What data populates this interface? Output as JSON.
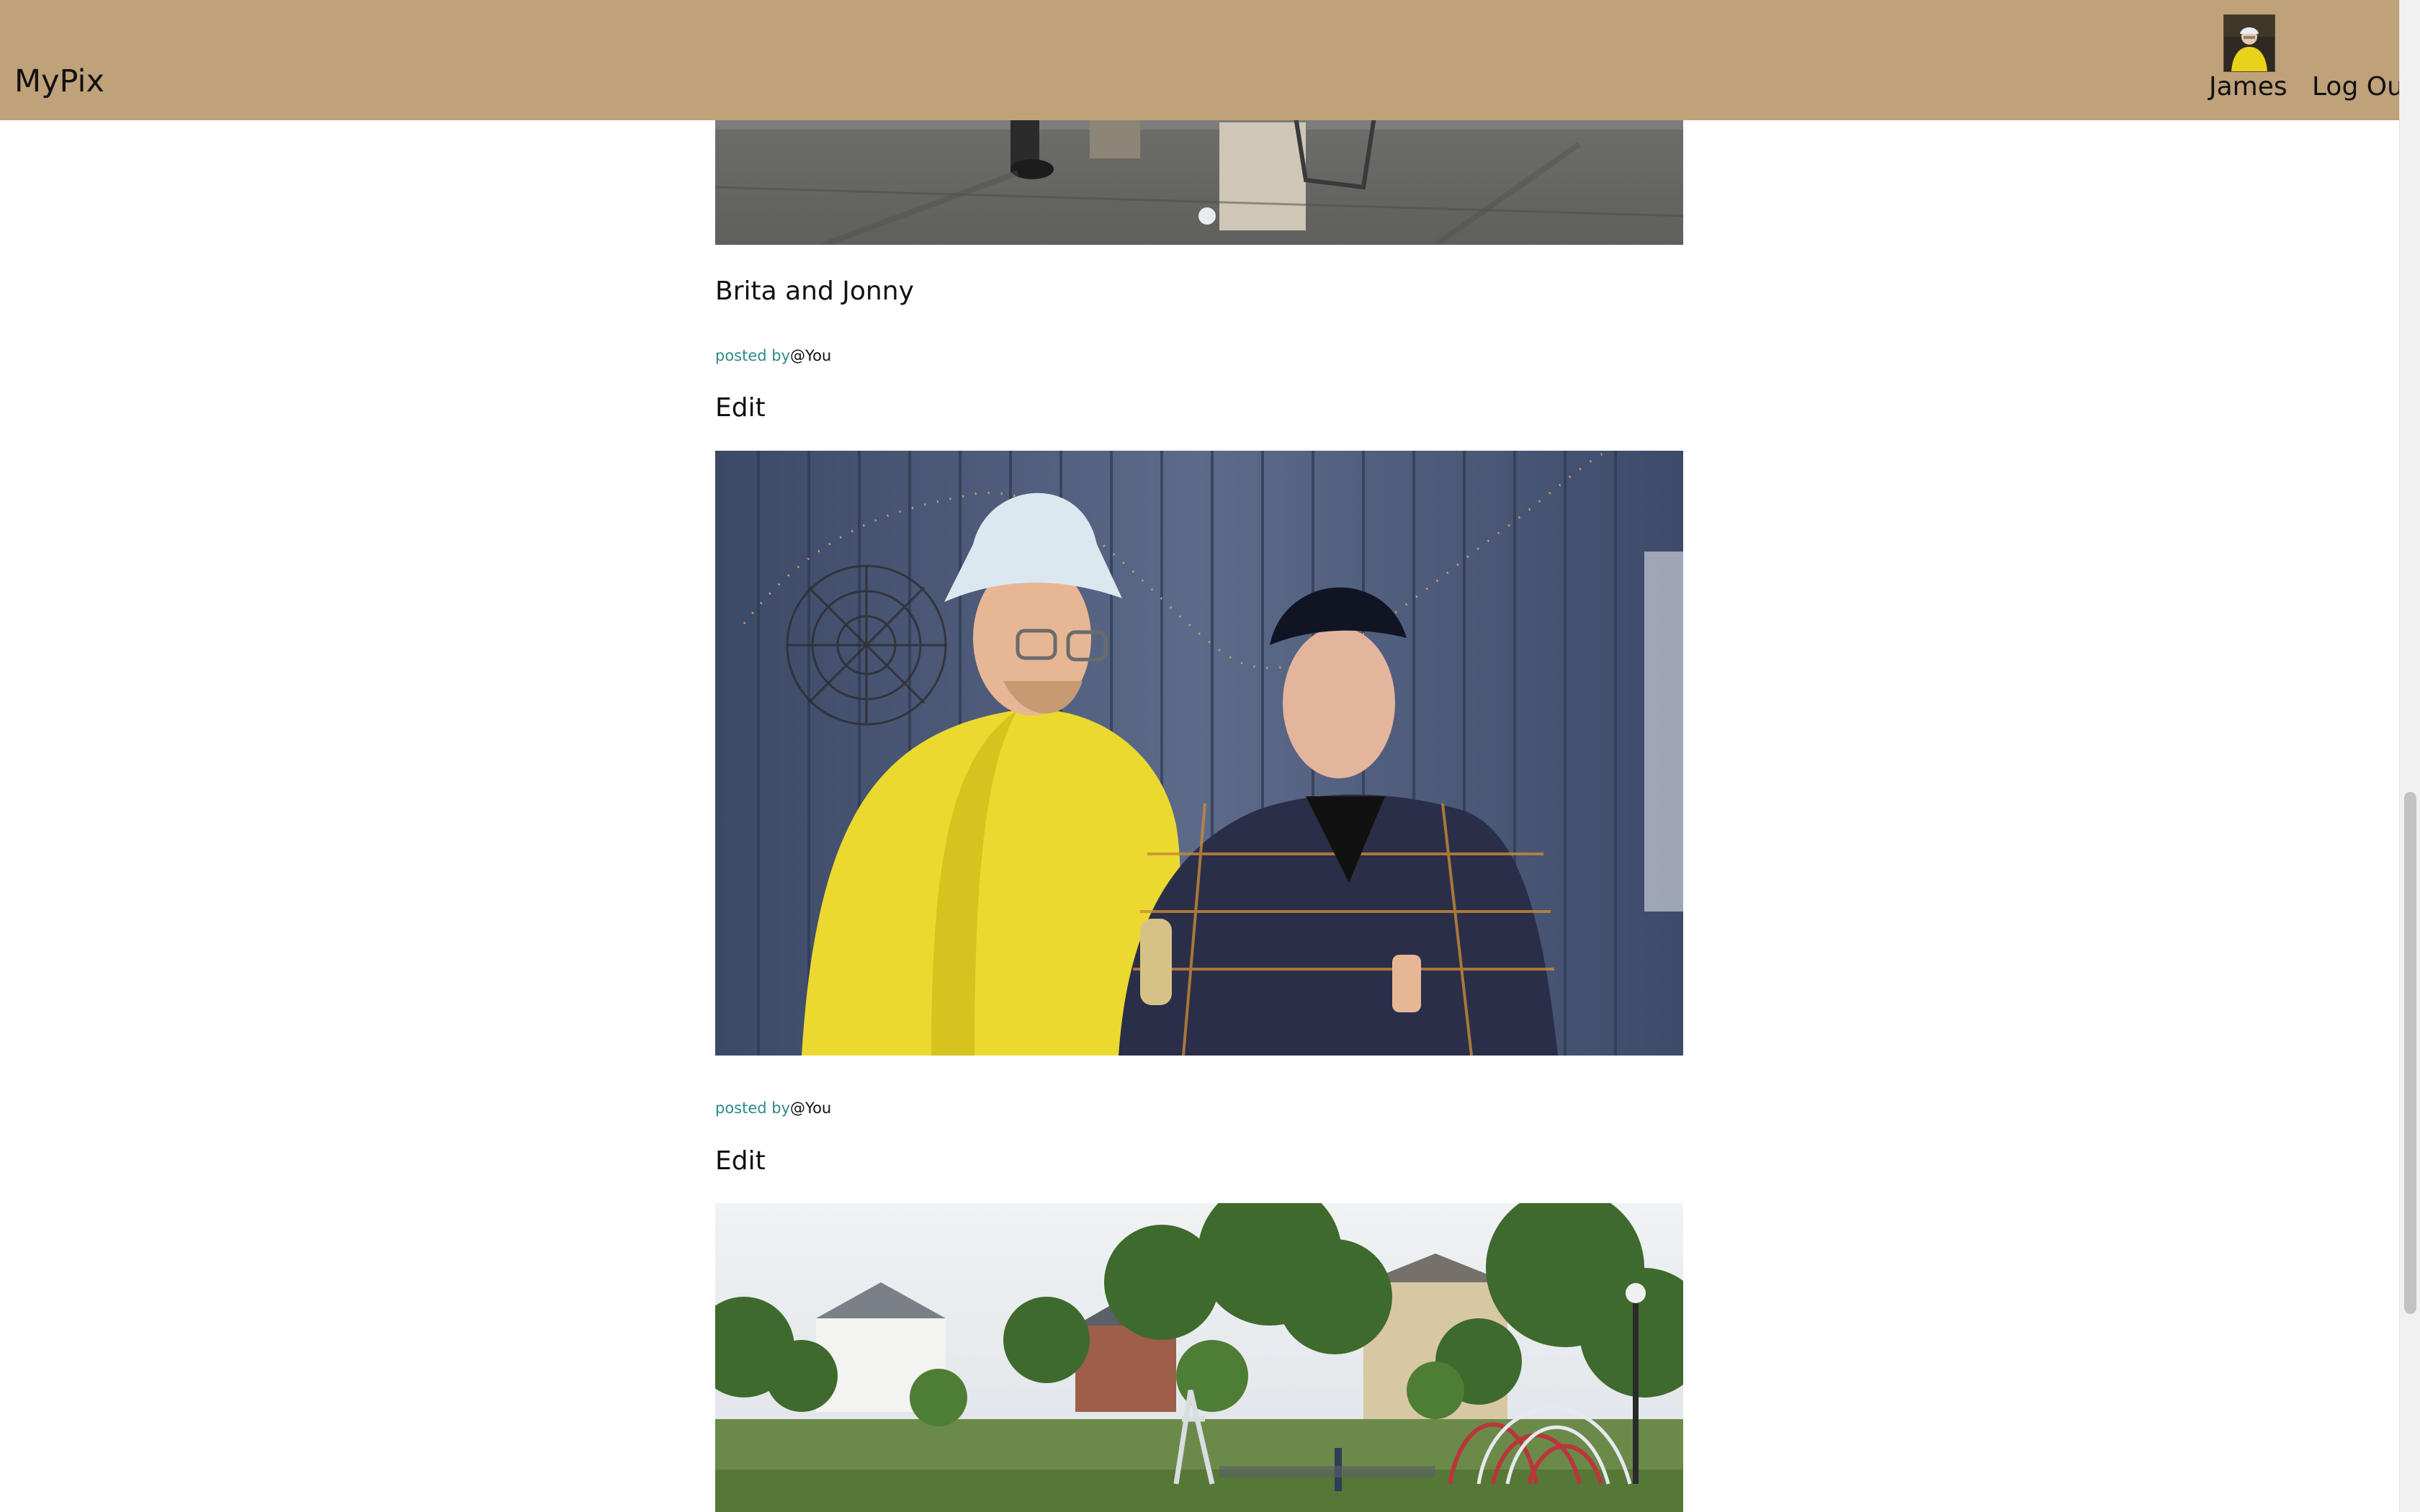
{
  "app": {
    "logo": "MyPix"
  },
  "nav": {
    "user_name": "James",
    "logout_label": "Log Out",
    "avatar_icon": "user-avatar"
  },
  "posts": [
    {
      "caption": "Brita and Jonny",
      "posted_prefix": "posted by",
      "posted_user": "@You",
      "edit_label": "Edit"
    },
    {
      "caption": "",
      "posted_prefix": "posted by",
      "posted_user": "@You",
      "edit_label": "Edit"
    }
  ],
  "colors": {
    "header": "#bfa17a",
    "posted_by": "#2c8a88"
  }
}
